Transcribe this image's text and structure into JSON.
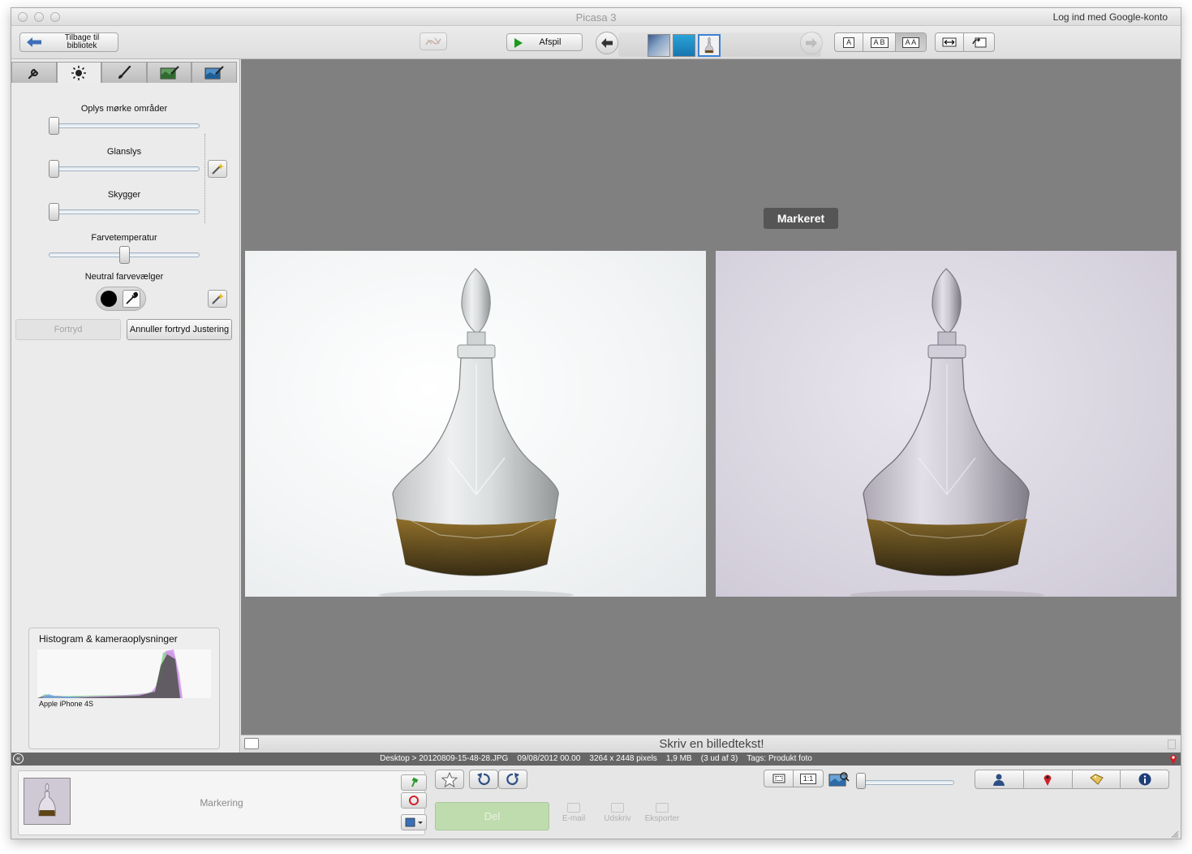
{
  "window": {
    "title": "Picasa 3",
    "signin": "Log ind med Google-konto"
  },
  "toolbar": {
    "back_label": "Tilbage til bibliotek",
    "play_label": "Afspil",
    "layout_options": [
      "A",
      "A B",
      "A A"
    ],
    "layout_selected": "A A"
  },
  "left_panel": {
    "tabs": [
      {
        "icon": "wrench-icon"
      },
      {
        "icon": "sun-icon"
      },
      {
        "icon": "brush-icon"
      },
      {
        "icon": "effects-green-icon"
      },
      {
        "icon": "effects-blue-icon"
      }
    ],
    "active_tab": 1,
    "sliders": [
      {
        "label": "Oplys mørke områder",
        "value": 0.0
      },
      {
        "label": "Glanslys",
        "value": 0.0
      },
      {
        "label": "Skygger",
        "value": 0.0
      },
      {
        "label": "Farvetemperatur",
        "value": 0.5
      }
    ],
    "neutral_label": "Neutral farvevælger",
    "undo_label": "Fortryd",
    "redo_label": "Annuller fortryd Justering",
    "histogram": {
      "title": "Histogram & kameraoplysninger",
      "camera": "Apple iPhone 4S"
    }
  },
  "main": {
    "badge": "Markeret",
    "caption_placeholder": "Skriv en billedtekst!"
  },
  "status": {
    "path": "Desktop > 20120809-15-48-28.JPG",
    "date": "09/08/2012 00.00",
    "dimensions": "3264 x 2448 pixels",
    "size": "1,9 MB",
    "position": "(3 ud af 3)",
    "tags": "Tags: Produkt foto"
  },
  "tray": {
    "selection_label": "Markering",
    "share_label": "Del",
    "email_label": "E-mail",
    "print_label": "Udskriv",
    "export_label": "Eksporter",
    "view_fit": "",
    "view_actual": "1:1",
    "zoom_level": 0.0
  },
  "colors": {
    "accent_blue": "#3d6fb6",
    "play_green": "#1b9a1b",
    "share_green": "#bfdcae",
    "main_bg": "#808080"
  }
}
